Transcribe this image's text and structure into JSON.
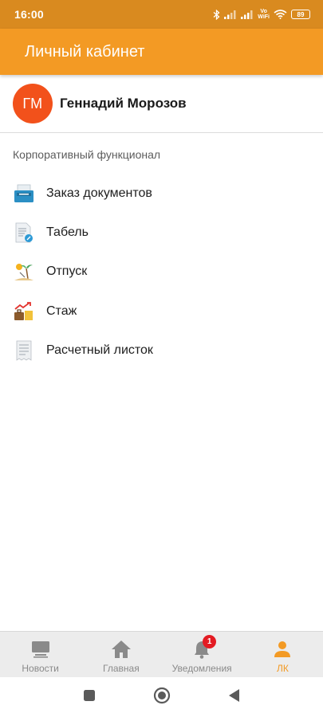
{
  "status_bar": {
    "time": "16:00",
    "vowifi_top": "Vo",
    "vowifi_bottom": "WiFi",
    "battery": "89"
  },
  "app_bar": {
    "title": "Личный кабинет"
  },
  "profile": {
    "initials": "ГМ",
    "name": "Геннадий Морозов",
    "avatar_color": "#f2511b"
  },
  "section": {
    "title": "Корпоративный функционал"
  },
  "menu": {
    "items": [
      {
        "label": "Заказ документов",
        "icon": "document-order-icon"
      },
      {
        "label": "Табель",
        "icon": "timesheet-icon"
      },
      {
        "label": "Отпуск",
        "icon": "vacation-icon"
      },
      {
        "label": "Стаж",
        "icon": "experience-icon"
      },
      {
        "label": "Расчетный листок",
        "icon": "payslip-icon"
      }
    ]
  },
  "bottom_nav": {
    "items": [
      {
        "label": "Новости",
        "icon": "news-icon"
      },
      {
        "label": "Главная",
        "icon": "home-icon"
      },
      {
        "label": "Уведомления",
        "icon": "bell-icon",
        "badge": "1"
      },
      {
        "label": "ЛК",
        "icon": "person-icon",
        "active": true
      }
    ]
  },
  "colors": {
    "status_bar": "#d98a1f",
    "app_bar": "#f39a24",
    "accent": "#f39a24",
    "badge": "#e31b23"
  }
}
